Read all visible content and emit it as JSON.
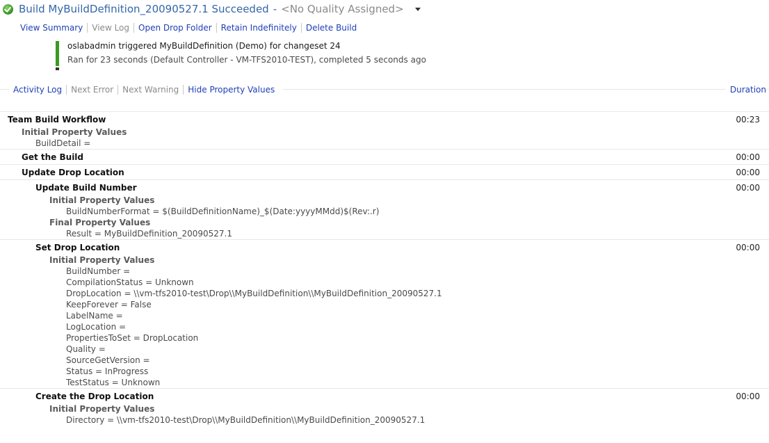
{
  "header": {
    "title": "Build MyBuildDefinition_20090527.1 Succeeded",
    "separator": "-",
    "quality": "<No Quality Assigned>"
  },
  "actions": [
    {
      "label": "View Summary",
      "enabled": true
    },
    {
      "label": "View Log",
      "enabled": false
    },
    {
      "label": "Open Drop Folder",
      "enabled": true
    },
    {
      "label": "Retain Indefinitely",
      "enabled": true
    },
    {
      "label": "Delete Build",
      "enabled": true
    }
  ],
  "trigger": {
    "line1": "oslabadmin triggered MyBuildDefinition (Demo) for changeset 24",
    "line2": "Ran for 23 seconds (Default Controller - VM-TFS2010-TEST), completed 5 seconds ago"
  },
  "log_links": [
    {
      "label": "Activity Log",
      "enabled": true
    },
    {
      "label": "Next Error",
      "enabled": false
    },
    {
      "label": "Next Warning",
      "enabled": false
    },
    {
      "label": "Hide Property Values",
      "enabled": true
    }
  ],
  "duration_header": "Duration",
  "activities": [
    {
      "type": "activity",
      "level": 0,
      "label": "Team Build Workflow",
      "duration": "00:23"
    },
    {
      "type": "group",
      "level": 1,
      "label": "Initial Property Values"
    },
    {
      "type": "prop",
      "level": 2,
      "label": "BuildDetail ="
    },
    {
      "type": "activity",
      "level": 1,
      "label": "Get the Build",
      "duration": "00:00"
    },
    {
      "type": "activity",
      "level": 1,
      "label": "Update Drop Location",
      "duration": "00:00"
    },
    {
      "type": "activity",
      "level": 2,
      "label": "Update Build Number",
      "duration": "00:00"
    },
    {
      "type": "group",
      "level": 3,
      "label": "Initial Property Values"
    },
    {
      "type": "prop",
      "level": 4,
      "label": "BuildNumberFormat = $(BuildDefinitionName)_$(Date:yyyyMMdd)$(Rev:.r)"
    },
    {
      "type": "group",
      "level": 3,
      "label": "Final Property Values"
    },
    {
      "type": "prop",
      "level": 4,
      "label": "Result = MyBuildDefinition_20090527.1"
    },
    {
      "type": "activity",
      "level": 2,
      "label": "Set Drop Location",
      "duration": "00:00"
    },
    {
      "type": "group",
      "level": 3,
      "label": "Initial Property Values"
    },
    {
      "type": "prop",
      "level": 4,
      "label": "BuildNumber ="
    },
    {
      "type": "prop",
      "level": 4,
      "label": "CompilationStatus = Unknown"
    },
    {
      "type": "prop",
      "level": 4,
      "label": "DropLocation = \\\\vm-tfs2010-test\\Drop\\\\MyBuildDefinition\\\\MyBuildDefinition_20090527.1"
    },
    {
      "type": "prop",
      "level": 4,
      "label": "KeepForever = False"
    },
    {
      "type": "prop",
      "level": 4,
      "label": "LabelName ="
    },
    {
      "type": "prop",
      "level": 4,
      "label": "LogLocation ="
    },
    {
      "type": "prop",
      "level": 4,
      "label": "PropertiesToSet = DropLocation"
    },
    {
      "type": "prop",
      "level": 4,
      "label": "Quality ="
    },
    {
      "type": "prop",
      "level": 4,
      "label": "SourceGetVersion ="
    },
    {
      "type": "prop",
      "level": 4,
      "label": "Status = InProgress"
    },
    {
      "type": "prop",
      "level": 4,
      "label": "TestStatus = Unknown"
    },
    {
      "type": "activity",
      "level": 2,
      "label": "Create the Drop Location",
      "duration": "00:00"
    },
    {
      "type": "group",
      "level": 3,
      "label": "Initial Property Values"
    },
    {
      "type": "prop",
      "level": 4,
      "label": "Directory = \\\\vm-tfs2010-test\\Drop\\\\MyBuildDefinition\\\\MyBuildDefinition_20090527.1"
    }
  ]
}
